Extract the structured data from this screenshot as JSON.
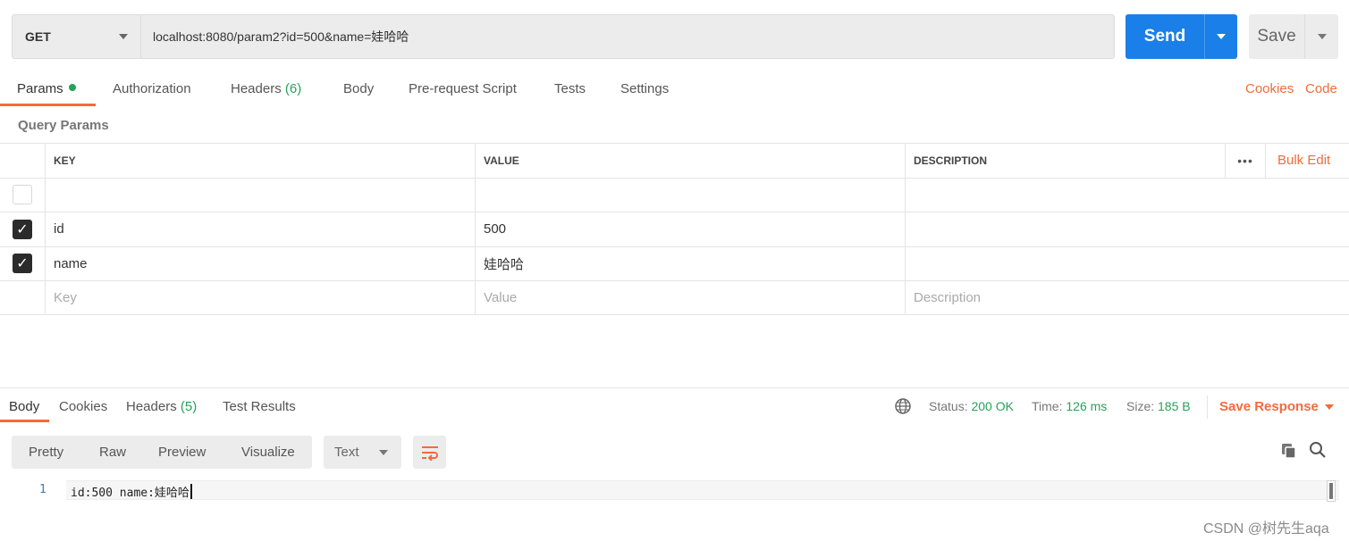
{
  "request": {
    "method": "GET",
    "url": "localhost:8080/param2?id=500&name=娃哈哈",
    "send_label": "Send",
    "save_label": "Save"
  },
  "request_tabs": {
    "params": "Params",
    "authorization": "Authorization",
    "headers": "Headers",
    "headers_count": "(6)",
    "body": "Body",
    "prerequest": "Pre-request Script",
    "tests": "Tests",
    "settings": "Settings",
    "cookies_link": "Cookies",
    "code_link": "Code"
  },
  "query_params": {
    "title": "Query Params",
    "columns": {
      "key": "KEY",
      "value": "VALUE",
      "description": "DESCRIPTION"
    },
    "bulk_edit": "Bulk Edit",
    "rows": [
      {
        "checked": false,
        "key": "",
        "value": "",
        "description": ""
      },
      {
        "checked": true,
        "key": "id",
        "value": "500",
        "description": ""
      },
      {
        "checked": true,
        "key": "name",
        "value": "娃哈哈",
        "description": ""
      }
    ],
    "placeholder": {
      "key": "Key",
      "value": "Value",
      "description": "Description"
    }
  },
  "response": {
    "tabs": {
      "body": "Body",
      "cookies": "Cookies",
      "headers": "Headers",
      "headers_count": "(5)",
      "test_results": "Test Results"
    },
    "status_label": "Status:",
    "status_value": "200 OK",
    "time_label": "Time:",
    "time_value": "126 ms",
    "size_label": "Size:",
    "size_value": "185 B",
    "save_response": "Save Response",
    "view_modes": {
      "pretty": "Pretty",
      "raw": "Raw",
      "preview": "Preview",
      "visualize": "Visualize"
    },
    "format": "Text",
    "lines": [
      {
        "number": "1",
        "text": "id:500 name:娃哈哈"
      }
    ]
  },
  "watermark": "CSDN @树先生aqa",
  "colors": {
    "accent": "#f26b3a",
    "send": "#1a7fe8",
    "success": "#27a25a"
  }
}
